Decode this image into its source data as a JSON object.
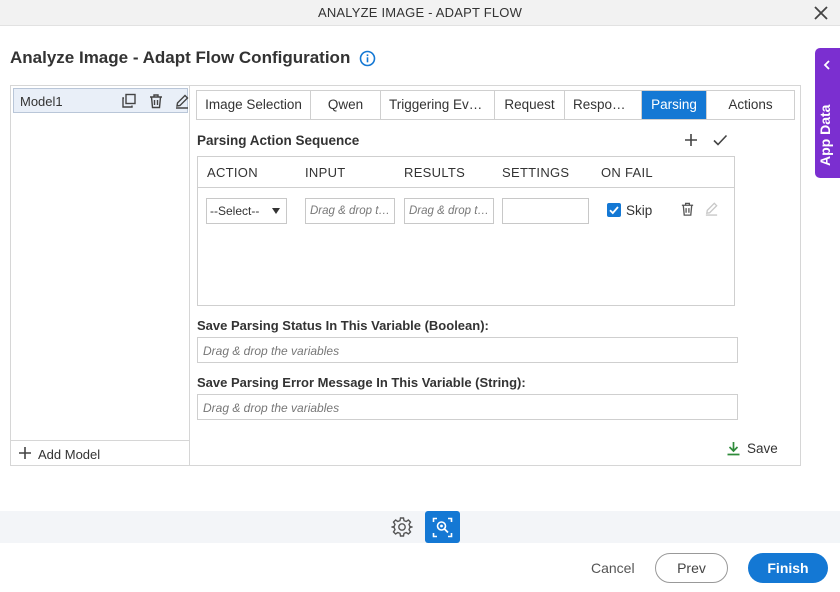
{
  "window": {
    "title": "ANALYZE IMAGE - ADAPT FLOW"
  },
  "page": {
    "heading": "Analyze Image - Adapt Flow Configuration"
  },
  "side_tab": {
    "label": "App Data"
  },
  "models": {
    "items": [
      {
        "label": "Model1"
      }
    ],
    "add_label": "Add Model"
  },
  "tabs": [
    {
      "label": "Image Selection",
      "active": false
    },
    {
      "label": "Qwen",
      "active": false
    },
    {
      "label": "Triggering Events",
      "active": false
    },
    {
      "label": "Request",
      "active": false
    },
    {
      "label": "Response",
      "active": false
    },
    {
      "label": "Parsing",
      "active": true
    },
    {
      "label": "Actions",
      "active": false
    }
  ],
  "parsing": {
    "section_title": "Parsing Action Sequence",
    "columns": [
      "ACTION",
      "INPUT",
      "RESULTS",
      "SETTINGS",
      "ON FAIL"
    ],
    "row": {
      "action_value": "--Select--",
      "input_placeholder": "Drag & drop the variables",
      "results_placeholder": "Drag & drop the variables",
      "on_fail_label": "Skip",
      "on_fail_checked": true
    },
    "status_label": "Save Parsing Status In This Variable (Boolean):",
    "status_placeholder": "Drag & drop the variables",
    "error_label": "Save Parsing Error Message In This Variable (String):",
    "error_placeholder": "Drag & drop the variables",
    "save_label": "Save"
  },
  "footer": {
    "cancel": "Cancel",
    "prev": "Prev",
    "finish": "Finish"
  },
  "colors": {
    "accent": "#1478d4",
    "side_tab": "#7b2fd0",
    "save_icon": "#2e8b3a"
  }
}
